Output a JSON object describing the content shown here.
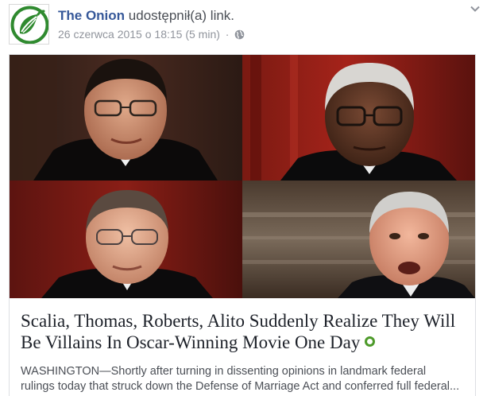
{
  "post": {
    "author": "The Onion",
    "action": "udostępnił(a) link.",
    "date": "26 czerwca 2015 o 18:15",
    "read_time": "(5 min)",
    "separator": "·",
    "privacy_icon": "globe-icon",
    "menu_icon": "chevron-down-icon"
  },
  "link": {
    "headline": "Scalia, Thomas, Roberts, Alito Suddenly Realize They Will Be Villains In Oscar-Winning Movie One Day",
    "description_line1": "WASHINGTON—Shortly after turning in dissenting opinions in landmark federal",
    "description_line2": "rulings today that struck down the Defense of Marriage Act and conferred full federal..."
  },
  "colors": {
    "author_link": "#365899",
    "meta_text": "#90949c",
    "headline_text": "#1d2129",
    "onion_green": "#4d9a2a"
  }
}
